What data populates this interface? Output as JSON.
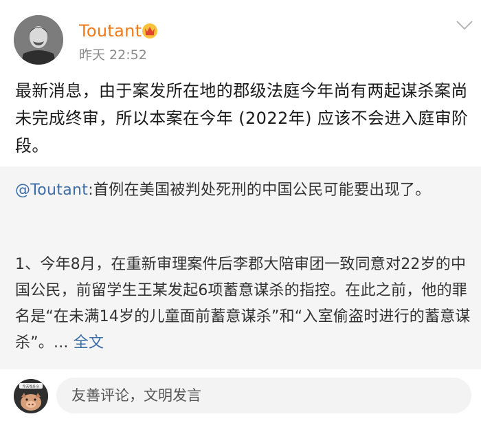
{
  "post": {
    "author": "Toutant",
    "time": "昨天 22:52",
    "text": "最新消息，由于案发所在地的郡级法庭今年尚有两起谋杀案尚未完成终审，所以本案在今年 (2022年) 应该不会进入庭审阶段。",
    "icons": {
      "avatar": "avatar-portrait",
      "badge": "vip-crown-icon",
      "more": "chevron-down-icon"
    }
  },
  "repost": {
    "mention": "@Toutant",
    "summary": ":首例在美国被判处死刑的中国公民可能要出现了。",
    "detail": "1、今年8月，在重新审理案件后李郡大陪审团一致同意对22岁的中国公民，前留学生王某发起6项蓄意谋杀的指控。在此之前，他的罪名是“在未满14岁的儿童面前蓄意谋杀”和“入室偷盗时进行的蓄意谋杀”。...",
    "full_text_link": "全文"
  },
  "comment_bar": {
    "placeholder": "友善评论，文明发言",
    "avatar_caption": "今天吃什么"
  },
  "colors": {
    "author": "#f27a1a",
    "link": "#3b6ea8",
    "repost_bg": "#f5f5f5",
    "input_bg": "#f3f3f3"
  }
}
